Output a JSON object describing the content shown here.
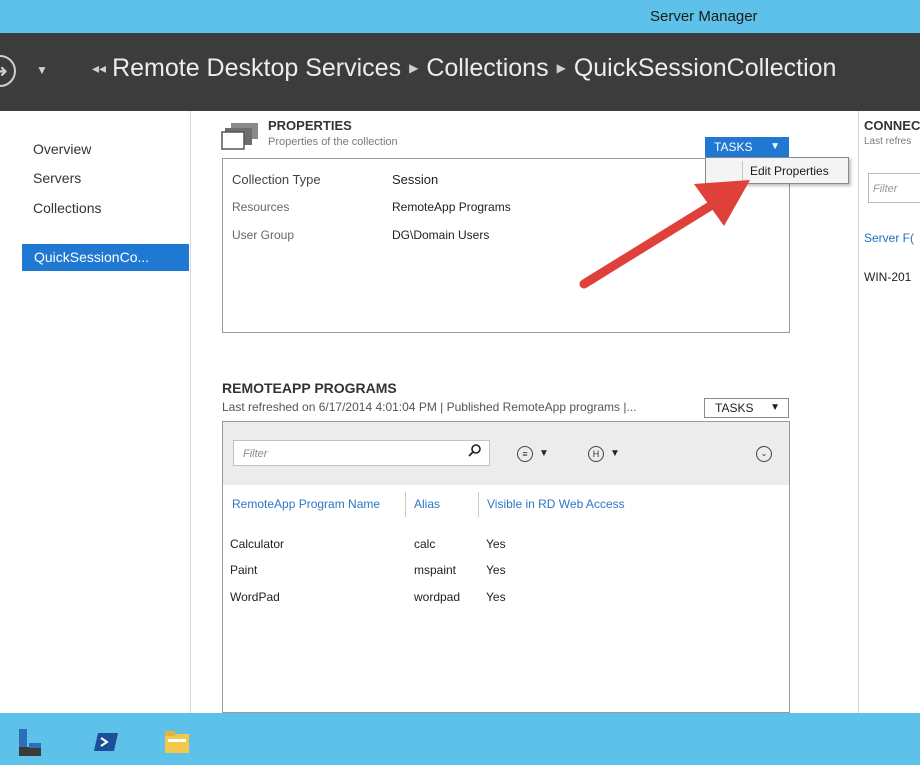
{
  "window": {
    "title": "Server Manager"
  },
  "breadcrumb": [
    "Remote Desktop Services",
    "Collections",
    "QuickSessionCollection"
  ],
  "sidebar": {
    "items": [
      "Overview",
      "Servers",
      "Collections"
    ],
    "active": "QuickSessionCo..."
  },
  "properties": {
    "title": "PROPERTIES",
    "subtitle": "Properties of the collection",
    "tasks_label": "TASKS",
    "rows": [
      {
        "label": "Collection Type",
        "value": "Session"
      },
      {
        "label": "Resources",
        "value": "RemoteApp Programs"
      },
      {
        "label": "User Group",
        "value": "DG\\Domain Users"
      }
    ]
  },
  "tasks_menu": {
    "items": [
      "Edit Properties"
    ]
  },
  "connections": {
    "title": "CONNEC",
    "subtitle": "Last refres",
    "filter_placeholder": "Filter",
    "column": "Server F(",
    "row": "WIN-201"
  },
  "remoteapp": {
    "title": "REMOTEAPP PROGRAMS",
    "subtitle": "Last refreshed on 6/17/2014 4:01:04 PM | Published RemoteApp programs |...",
    "tasks_label": "TASKS",
    "filter_placeholder": "Filter",
    "columns": [
      "RemoteApp Program Name",
      "Alias",
      "Visible in RD Web Access"
    ],
    "rows": [
      [
        "Calculator",
        "calc",
        "Yes"
      ],
      [
        "Paint",
        "mspaint",
        "Yes"
      ],
      [
        "WordPad",
        "wordpad",
        "Yes"
      ]
    ]
  },
  "colors": {
    "accent": "#1f78d1",
    "titlebar": "#5dc1ea",
    "navbar": "#3c3c3c",
    "arrow": "#e0403a"
  }
}
